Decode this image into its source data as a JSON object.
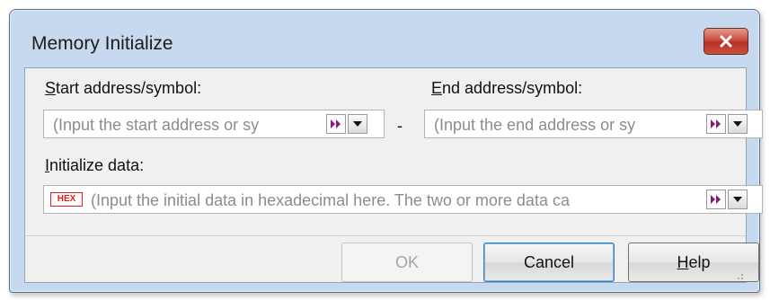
{
  "window": {
    "title": "Memory Initialize",
    "close_icon": "close-x-icon",
    "close_color": "#c9473a"
  },
  "start": {
    "label_accel": "S",
    "label_rest": "tart address/symbol:",
    "placeholder": "(Input the start address or sy",
    "symbol_icon": "symbol-arrow-icon",
    "dropdown_icon": "chevron-down-icon"
  },
  "range_separator": "-",
  "end": {
    "label_accel": "E",
    "label_rest": "nd address/symbol:",
    "placeholder": "(Input the end address or sy",
    "symbol_icon": "symbol-arrow-icon",
    "dropdown_icon": "chevron-down-icon"
  },
  "data": {
    "label_accel": "I",
    "label_rest": "nitialize data:",
    "hex_badge": "HEX",
    "placeholder": "(Input the initial data in hexadecimal here. The two or more data ca",
    "symbol_icon": "symbol-arrow-icon",
    "dropdown_icon": "chevron-down-icon"
  },
  "buttons": {
    "ok": "OK",
    "cancel": "Cancel",
    "help_accel": "H",
    "help_rest": "elp"
  }
}
